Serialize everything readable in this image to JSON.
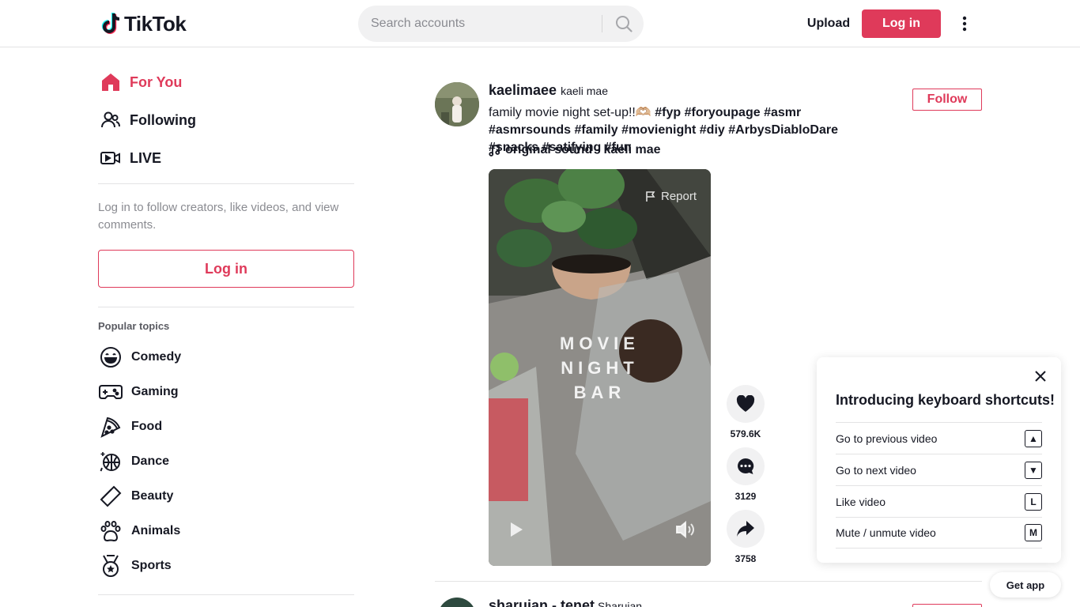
{
  "colors": {
    "brand": "#df3a5a",
    "text": "#161823",
    "muted": "#8a8b91",
    "surface": "#f1f1f2"
  },
  "header": {
    "logo_text": "TikTok",
    "search_placeholder": "Search accounts",
    "upload_label": "Upload",
    "login_label": "Log in"
  },
  "sidebar": {
    "nav": [
      {
        "label": "For You",
        "icon": "home-icon",
        "active": true
      },
      {
        "label": "Following",
        "icon": "people-icon",
        "active": false
      },
      {
        "label": "LIVE",
        "icon": "live-icon",
        "active": false
      }
    ],
    "login_note": "Log in to follow creators, like videos, and view comments.",
    "login_button": "Log in",
    "topics_title": "Popular topics",
    "topics": [
      {
        "label": "Comedy",
        "icon": "comedy-icon"
      },
      {
        "label": "Gaming",
        "icon": "gamepad-icon"
      },
      {
        "label": "Food",
        "icon": "pizza-icon"
      },
      {
        "label": "Dance",
        "icon": "disco-ball-icon"
      },
      {
        "label": "Beauty",
        "icon": "comb-icon"
      },
      {
        "label": "Animals",
        "icon": "paw-icon"
      },
      {
        "label": "Sports",
        "icon": "medal-icon"
      }
    ]
  },
  "post": {
    "username": "kaelimaee",
    "nickname": "kaeli mae",
    "caption_text": "family movie night set-up!!🫶🏼",
    "hashtags": [
      "#fyp",
      "#foryoupage",
      "#asmr",
      "#asmrsounds",
      "#family",
      "#movienight",
      "#diy",
      "#ArbysDiabloDare",
      "#snacks",
      "#satifying",
      "#fun"
    ],
    "music": "original sound - kaeli mae",
    "follow_label": "Follow",
    "report_label": "Report",
    "overlay_lines": [
      "MOVIE",
      "NIGHT",
      "BAR"
    ],
    "likes": "579.6K",
    "comments": "3129",
    "shares": "3758"
  },
  "next_post": {
    "username": "sharujan - tenet",
    "nickname": "Sharujan"
  },
  "shortcuts": {
    "title": "Introducing keyboard shortcuts!",
    "items": [
      {
        "label": "Go to previous video",
        "key": "▲"
      },
      {
        "label": "Go to next video",
        "key": "▼"
      },
      {
        "label": "Like video",
        "key": "L"
      },
      {
        "label": "Mute / unmute video",
        "key": "M"
      }
    ]
  },
  "get_app_label": "Get app"
}
